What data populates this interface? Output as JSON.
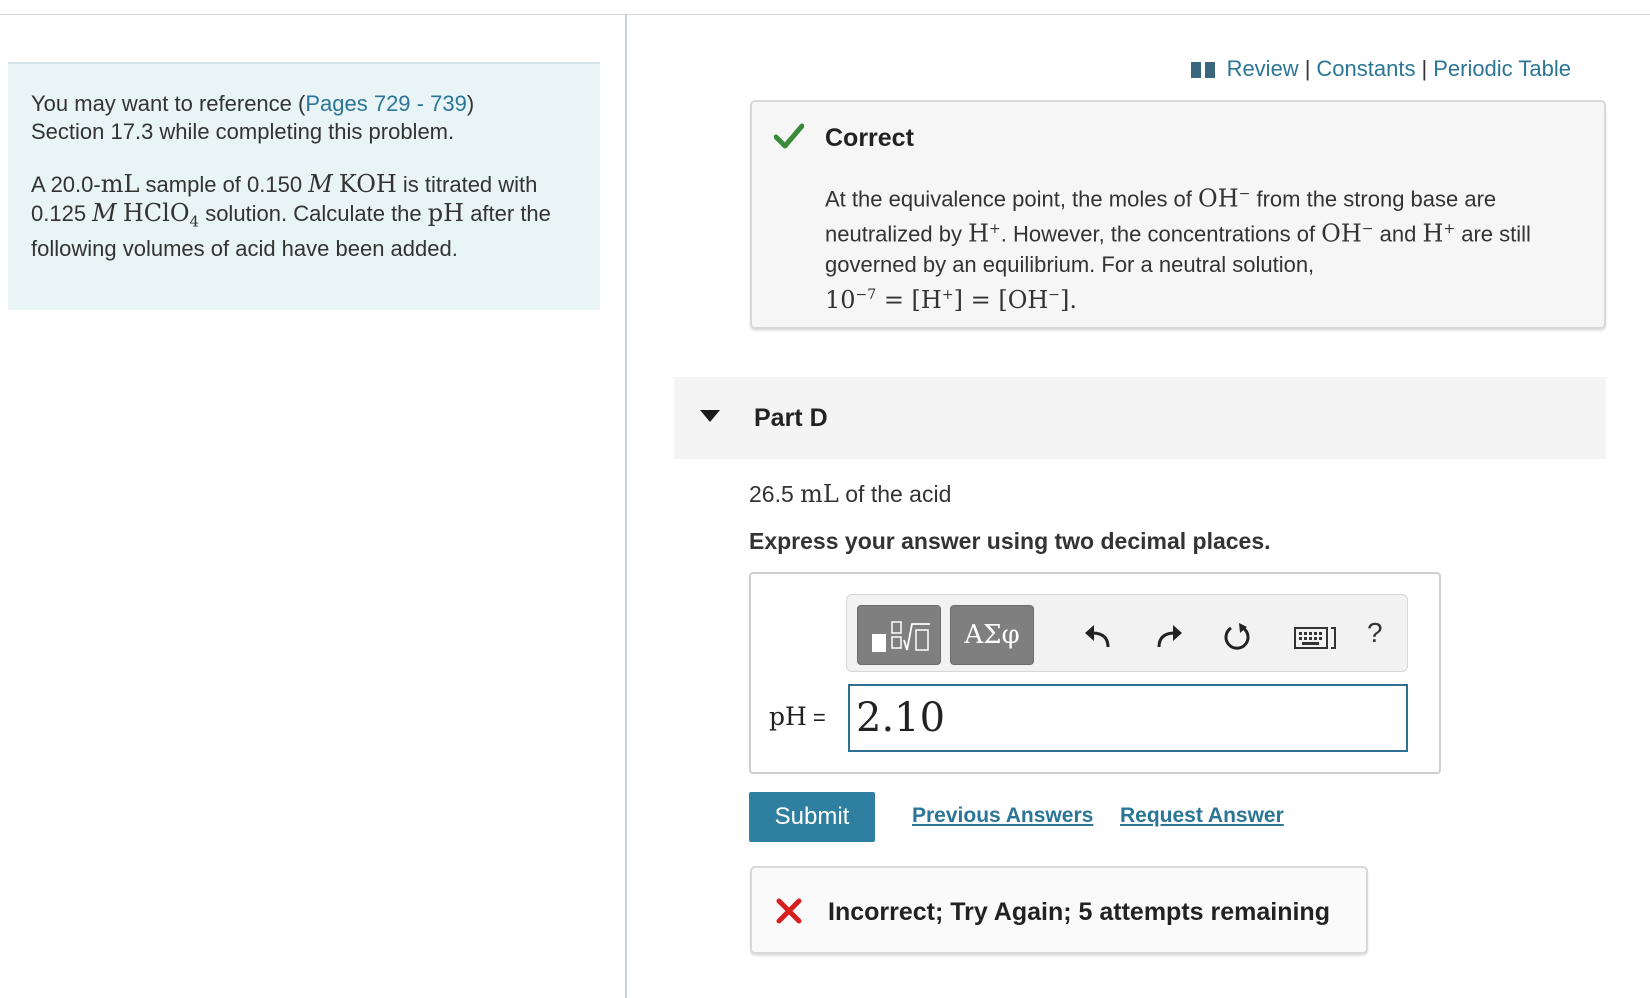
{
  "reference": {
    "prefix": "You may want to reference (",
    "pages_link": "Pages 729 - 739",
    "suffix": ")",
    "section_line": "Section 17.3 while completing this problem.",
    "problem": {
      "t1": "A 20.0-",
      "unit_ml": "mL",
      "t2": " sample of 0.150 ",
      "molar": "M",
      "koh": "KOH",
      "t3": " is titrated with 0.125 ",
      "hclo": "HClO",
      "four": "4",
      "t4": " solution. Calculate the ",
      "ph": "pH",
      "t5": " after the following volumes of acid have been added."
    }
  },
  "top_links": {
    "review": "Review",
    "sep": "|",
    "constants": "Constants",
    "periodic_table": "Periodic Table"
  },
  "feedback_correct": {
    "title": "Correct",
    "t1": "At the equivalence point, the moles of ",
    "oh": "OH",
    "minus": "−",
    "t2": " from the strong base are neutralized by ",
    "h": "H",
    "plus": "+",
    "t3": ". However, the concentrations of ",
    "t4": " and ",
    "t5": " are still governed by an equilibrium. For a neutral solution,",
    "eq_base": "10",
    "eq_exp": "−7",
    "eq_rest1": " = [H",
    "eq_rest2": "] = [OH",
    "eq_rest3": "]."
  },
  "part": {
    "title": "Part D",
    "volume": "26.5 ",
    "unit": "mL",
    "question_rest": " of the acid",
    "instruction": "Express your answer using two decimal places."
  },
  "toolbar": {
    "greek_label": "ΑΣφ",
    "help": "?"
  },
  "answer": {
    "label": "pH",
    "equals": " =",
    "value": "2.10"
  },
  "actions": {
    "submit": "Submit",
    "previous": "Previous Answers",
    "request": "Request Answer"
  },
  "feedback_incorrect": {
    "text": "Incorrect; Try Again; 5 attempts remaining"
  },
  "colors": {
    "link": "#2b7596",
    "submit": "#2f7fa0",
    "correct_green": "#3a8a3a",
    "incorrect_red": "#d62020"
  }
}
